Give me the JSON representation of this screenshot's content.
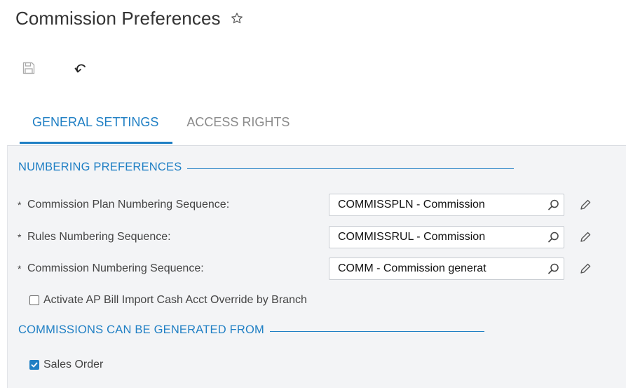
{
  "header": {
    "title": "Commission Preferences",
    "favorite_icon": "star-outline-icon"
  },
  "toolbar": {
    "save_icon": "save-icon",
    "undo_icon": "undo-icon"
  },
  "tabs": [
    {
      "label": "GENERAL SETTINGS",
      "active": true
    },
    {
      "label": "ACCESS RIGHTS",
      "active": false
    }
  ],
  "numbering": {
    "title": "NUMBERING PREFERENCES",
    "fields": [
      {
        "label": "Commission Plan Numbering Sequence:",
        "value": "COMMISSPLN - Commission",
        "required": "*"
      },
      {
        "label": "Rules Numbering Sequence:",
        "value": "COMMISSRUL - Commission",
        "required": "*"
      },
      {
        "label": "Commission Numbering Sequence:",
        "value": "COMM - Commission generat",
        "required": "*"
      }
    ],
    "ap_override": {
      "label": "Activate AP Bill Import Cash Acct Override by Branch",
      "checked": false
    }
  },
  "generated_from": {
    "title": "COMMISSIONS CAN BE GENERATED FROM",
    "sales_order": {
      "label": "Sales Order",
      "checked": true
    }
  },
  "colors": {
    "accent": "#1f7fc4",
    "panel_bg": "#f3f4f6"
  }
}
